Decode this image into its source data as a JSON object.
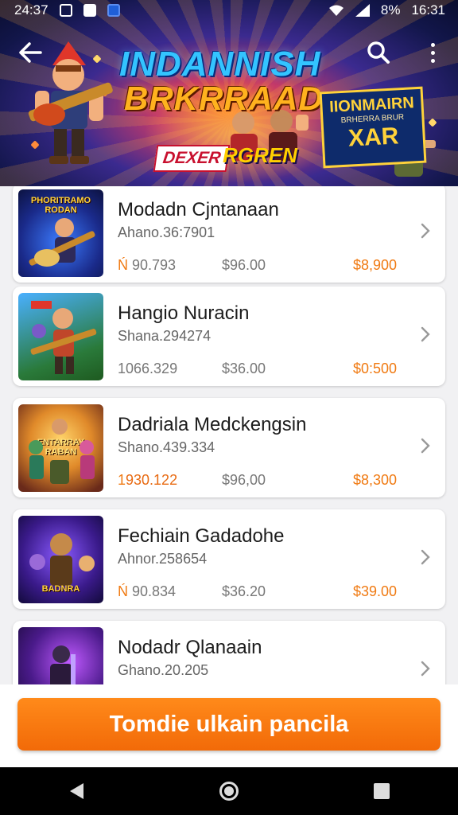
{
  "status_bar": {
    "time_left": "24:37",
    "battery": "8%",
    "time_right": "16:31"
  },
  "hero": {
    "title_line1": "INDANNISH",
    "title_line2": "BRKRRAAD",
    "badge_left": "DEXER",
    "badge_right": "RGREN",
    "sign_line1": "IIONMAIRN",
    "sign_line2": "BRHERRA BRUR",
    "sign_line3": "XAR",
    "accent_cyan": "#33c4ff",
    "accent_gold": "#ffb21e"
  },
  "items": [
    {
      "title": "Modadn Cjntanaan",
      "subtitle": "Ahano.36:7901",
      "value1_prefix": "Ń",
      "value1": " 90.793",
      "value2": "$96.00",
      "value3": "$8,900",
      "thumb_label": "PHORITRAMO RODAN",
      "icon": "guitar-hero-thumb"
    },
    {
      "title": "Hangio Nuracin",
      "subtitle": "Shana.294274",
      "value1_prefix": "",
      "value1": "1066.329",
      "value2": "$36.00",
      "value3": "$0:500",
      "thumb_label": "",
      "icon": "guitar-warrior-thumb"
    },
    {
      "title": "Dadriala Medckengsin",
      "subtitle": "Shano.439.334",
      "value1_prefix": "1",
      "value1": "930.122",
      "value2": "$96,00",
      "value3": "$8,300",
      "thumb_label": "ENTARRAY RABAN",
      "icon": "squad-thumb"
    },
    {
      "title": "Fechiain Gadadohe",
      "subtitle": "Ahnor.258654",
      "value1_prefix": "Ń",
      "value1": " 90.834",
      "value2": "$36.20",
      "value3": "$39.00",
      "thumb_label": "BADNRA",
      "icon": "heroes-thumb"
    },
    {
      "title": "Nodadr Qlanaain",
      "subtitle": "Ghano.20.205",
      "value1_prefix": "",
      "value1": "",
      "value2": "",
      "value3": "",
      "thumb_label": "",
      "icon": "dark-knight-thumb"
    }
  ],
  "cta": {
    "label": "Tomdie ulkain pancila",
    "color": "#f57a10"
  },
  "nav": {
    "back": "back-triangle",
    "home": "home-circle",
    "recent": "recent-square"
  }
}
